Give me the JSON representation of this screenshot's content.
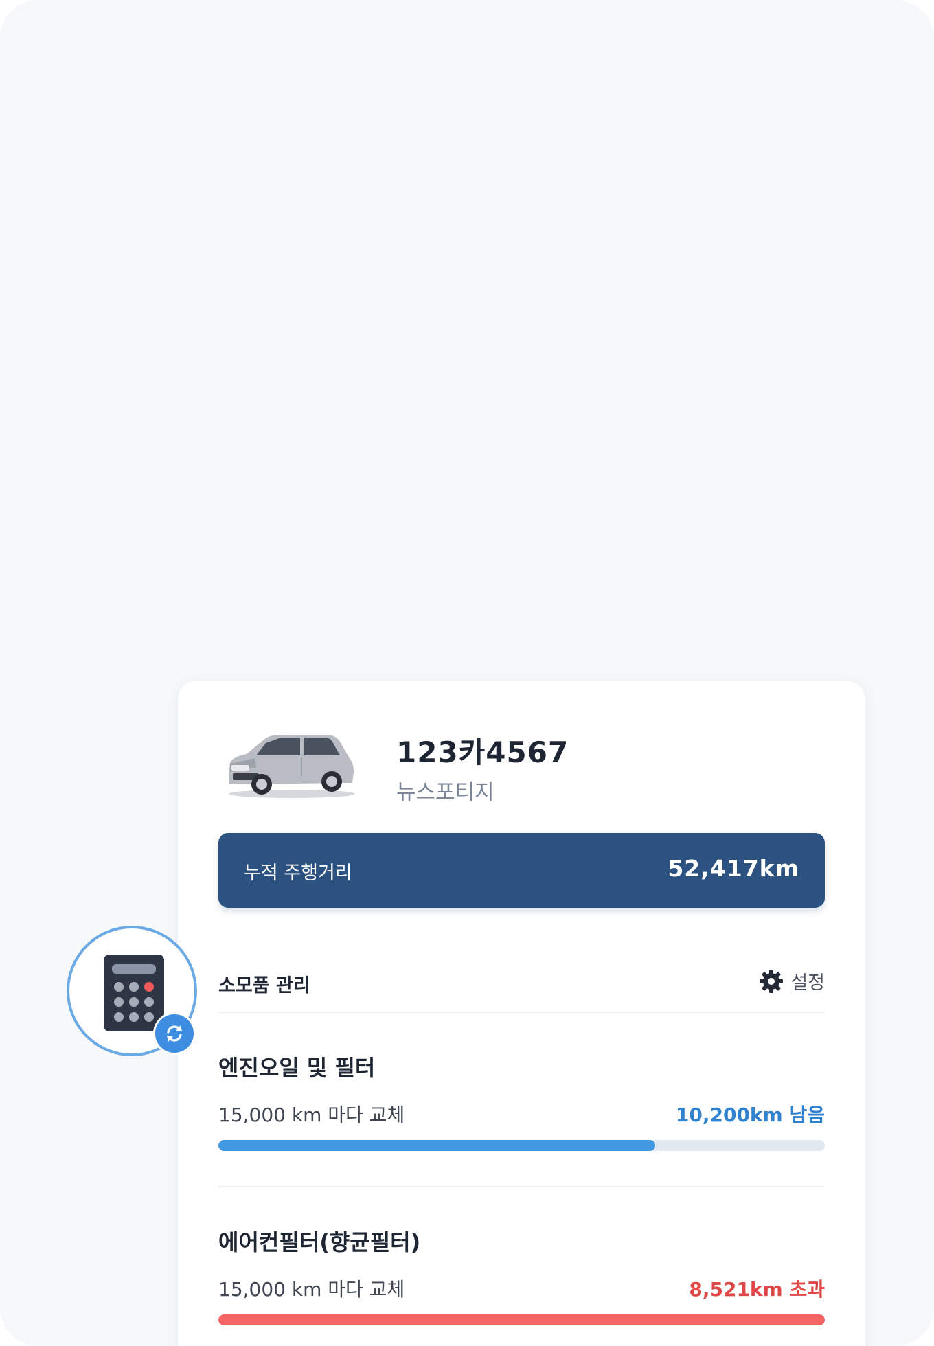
{
  "vehicle": {
    "plate": "123카4567",
    "model": "뉴스포티지",
    "image_icon": "suv-car-image"
  },
  "odometer": {
    "label": "누적 주행거리",
    "value": "52,417km"
  },
  "consumables": {
    "title": "소모품 관리",
    "settings_label": "설정",
    "settings_icon": "gear-icon",
    "items": [
      {
        "name": "엔진오일 및 필터",
        "interval": "15,000 km 마다 교체",
        "status": "10,200km 남음",
        "status_type": "remaining",
        "progress_percent": 72
      },
      {
        "name": "에어컨필터(향균필터)",
        "interval": "15,000 km 마다 교체",
        "status": "8,521km 초과",
        "status_type": "exceeded",
        "progress_percent": 100
      }
    ]
  },
  "fab": {
    "icon": "calculator-icon",
    "badge_icon": "sync-icon"
  },
  "colors": {
    "primary": "#2c5282",
    "remaining": "#3182ce",
    "exceeded": "#e04848",
    "bar_remaining": "#4299e1",
    "bar_exceeded": "#f56565",
    "background": "#f6f8fa"
  }
}
